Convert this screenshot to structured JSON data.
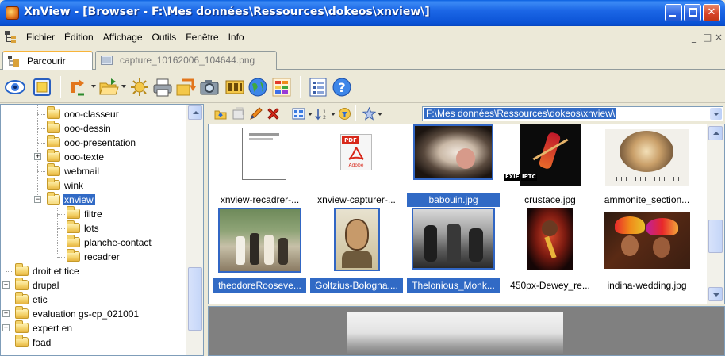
{
  "window": {
    "title": "XnView - [Browser - F:\\Mes données\\Ressources\\dokeos\\xnview\\]"
  },
  "menu": {
    "items": [
      "Fichier",
      "Édition",
      "Affichage",
      "Outils",
      "Fenêtre",
      "Info"
    ],
    "mdi_controls": [
      "_",
      "□",
      "×"
    ]
  },
  "tabs": [
    {
      "label": "Parcourir",
      "active": true
    },
    {
      "label": "capture_10162006_104644.png",
      "active": false
    }
  ],
  "toolbar": {
    "icons": [
      "eye-icon",
      "fullscreen-icon",
      "convert-icon",
      "open-folder-icon",
      "scan-icon",
      "print-icon",
      "export-icon",
      "camera-icon",
      "filmstrip-icon",
      "web-icon",
      "palette-icon",
      "details-icon",
      "help-icon"
    ]
  },
  "tree": {
    "items": [
      {
        "label": "ooo-classeur",
        "level": 3,
        "expander": ""
      },
      {
        "label": "ooo-dessin",
        "level": 3,
        "expander": ""
      },
      {
        "label": "ooo-presentation",
        "level": 3,
        "expander": ""
      },
      {
        "label": "ooo-texte",
        "level": 3,
        "expander": "+"
      },
      {
        "label": "webmail",
        "level": 3,
        "expander": ""
      },
      {
        "label": "wink",
        "level": 3,
        "expander": ""
      },
      {
        "label": "xnview",
        "level": 3,
        "expander": "−",
        "selected": true
      },
      {
        "label": "filtre",
        "level": 4,
        "expander": ""
      },
      {
        "label": "lots",
        "level": 4,
        "expander": ""
      },
      {
        "label": "planche-contact",
        "level": 4,
        "expander": ""
      },
      {
        "label": "recadrer",
        "level": 4,
        "expander": ""
      },
      {
        "label": "droit et tice",
        "level": 1,
        "expander": ""
      },
      {
        "label": "drupal",
        "level": 1,
        "expander": "+"
      },
      {
        "label": "etic",
        "level": 1,
        "expander": ""
      },
      {
        "label": "evaluation gs-cp_021001",
        "level": 1,
        "expander": "+"
      },
      {
        "label": "expert en",
        "level": 1,
        "expander": "+"
      },
      {
        "label": "foad",
        "level": 1,
        "expander": ""
      }
    ]
  },
  "path": {
    "value": "F:\\Mes données\\Ressources\\dokeos\\xnview\\"
  },
  "thumbnails": {
    "row1": [
      {
        "name": "xnview-recadrer-...",
        "selected": false
      },
      {
        "name": "xnview-capturer-...",
        "selected": false
      },
      {
        "name": "babouin.jpg",
        "selected": true
      },
      {
        "name": "crustace.jpg",
        "selected": false,
        "badges": [
          "EXIF",
          "IPTC"
        ]
      },
      {
        "name": "ammonite_section...",
        "selected": false
      }
    ],
    "row2": [
      {
        "name": "theodoreRooseve...",
        "selected": true
      },
      {
        "name": "Goltzius-Bologna....",
        "selected": true
      },
      {
        "name": "Thelonious_Monk...",
        "selected": true
      },
      {
        "name": "450px-Dewey_re...",
        "selected": false
      },
      {
        "name": "indina-wedding.jpg",
        "selected": false
      }
    ],
    "pdf_label": "PDF",
    "pdf_sub": "Adobe"
  }
}
